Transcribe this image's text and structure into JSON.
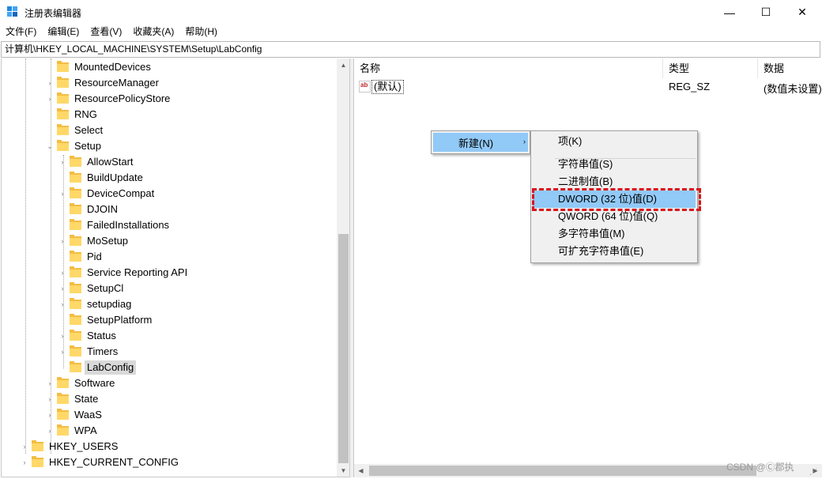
{
  "window": {
    "title": "注册表编辑器",
    "min_glyph": "—",
    "max_glyph": "☐",
    "close_glyph": "✕"
  },
  "menubar": {
    "items": [
      "文件(F)",
      "编辑(E)",
      "查看(V)",
      "收藏夹(A)",
      "帮助(H)"
    ]
  },
  "address": "计算机\\HKEY_LOCAL_MACHINE\\SYSTEM\\Setup\\LabConfig",
  "tree": {
    "items": [
      {
        "label": "MountedDevices",
        "chevron": ""
      },
      {
        "label": "ResourceManager",
        "chevron": "›"
      },
      {
        "label": "ResourcePolicyStore",
        "chevron": "›"
      },
      {
        "label": "RNG",
        "chevron": ""
      },
      {
        "label": "Select",
        "chevron": ""
      },
      {
        "label": "Setup",
        "chevron": "⌄"
      },
      {
        "label": "AllowStart",
        "chevron": "›"
      },
      {
        "label": "BuildUpdate",
        "chevron": ""
      },
      {
        "label": "DeviceCompat",
        "chevron": "›"
      },
      {
        "label": "DJOIN",
        "chevron": ""
      },
      {
        "label": "FailedInstallations",
        "chevron": ""
      },
      {
        "label": "MoSetup",
        "chevron": "›"
      },
      {
        "label": "Pid",
        "chevron": ""
      },
      {
        "label": "Service Reporting API",
        "chevron": "›"
      },
      {
        "label": "SetupCl",
        "chevron": "›"
      },
      {
        "label": "setupdiag",
        "chevron": "›"
      },
      {
        "label": "SetupPlatform",
        "chevron": ""
      },
      {
        "label": "Status",
        "chevron": "›"
      },
      {
        "label": "Timers",
        "chevron": "›"
      },
      {
        "label": "LabConfig",
        "chevron": "",
        "selected": true
      },
      {
        "label": "Software",
        "chevron": "›"
      },
      {
        "label": "State",
        "chevron": "›"
      },
      {
        "label": "WaaS",
        "chevron": "›"
      },
      {
        "label": "WPA",
        "chevron": "›"
      },
      {
        "label": "HKEY_USERS",
        "chevron": "›"
      },
      {
        "label": "HKEY_CURRENT_CONFIG",
        "chevron": "›"
      }
    ]
  },
  "list": {
    "columns": {
      "name": "名称",
      "type": "类型",
      "data": "数据"
    },
    "rows": [
      {
        "icon": "ab",
        "name": "(默认)",
        "type": "REG_SZ",
        "data": "(数值未设置)"
      }
    ]
  },
  "context_menu": {
    "new_label": "新建(N)",
    "arrow": "›"
  },
  "submenu": {
    "items": [
      "项(K)",
      "字符串值(S)",
      "二进制值(B)",
      "DWORD (32 位)值(D)",
      "QWORD (64 位)值(Q)",
      "多字符串值(M)",
      "可扩充字符串值(E)"
    ],
    "highlighted_index": 3
  },
  "watermark": "CSDN @Ⓒ郡执",
  "colors": {
    "menu_highlight": "#91c9f7",
    "annotation_red": "#d8141a",
    "folder": "#ffd867"
  }
}
